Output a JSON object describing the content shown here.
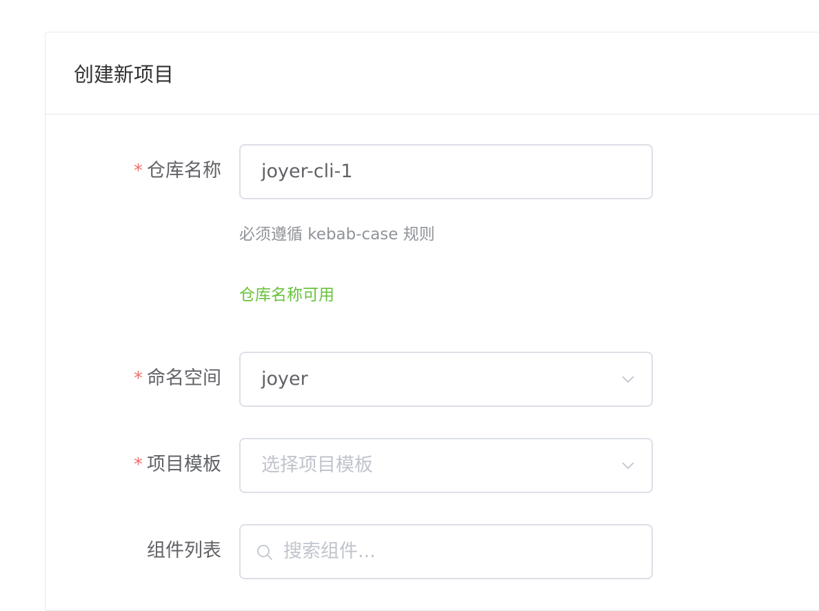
{
  "card": {
    "title": "创建新项目"
  },
  "form": {
    "repo_name": {
      "label": "仓库名称",
      "required_mark": "*",
      "value": "joyer-cli-1",
      "hint": "必须遵循 kebab-case 规则",
      "status": "仓库名称可用"
    },
    "namespace": {
      "label": "命名空间",
      "required_mark": "*",
      "value": "joyer",
      "icon": "chevron-down-icon"
    },
    "template": {
      "label": "项目模板",
      "required_mark": "*",
      "placeholder": "选择项目模板",
      "icon": "chevron-down-icon"
    },
    "components": {
      "label": "组件列表",
      "placeholder": "搜索组件...",
      "icon": "search-icon"
    }
  },
  "colors": {
    "required": "#f56c6c",
    "success": "#67c23a",
    "border": "#dcdfe6",
    "text": "#606266",
    "placeholder": "#c0c4cc"
  }
}
